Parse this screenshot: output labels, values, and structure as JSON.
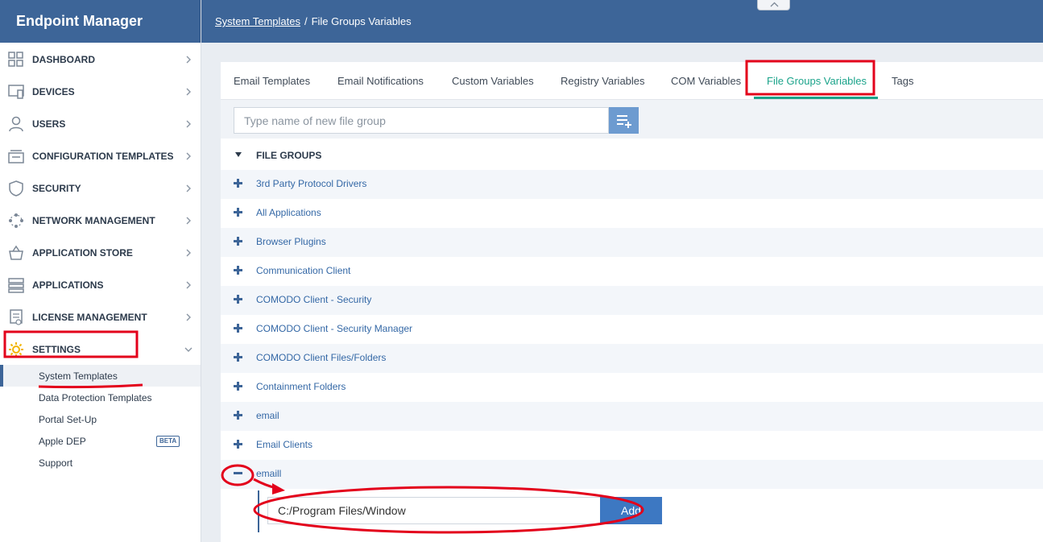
{
  "app": {
    "title": "Endpoint Manager"
  },
  "breadcrumb": {
    "parent": "System Templates",
    "separator": "/",
    "current": "File Groups Variables"
  },
  "sidebar": {
    "items": [
      {
        "label": "DASHBOARD",
        "icon": "dashboard-icon"
      },
      {
        "label": "DEVICES",
        "icon": "devices-icon"
      },
      {
        "label": "USERS",
        "icon": "user-icon"
      },
      {
        "label": "CONFIGURATION TEMPLATES",
        "icon": "templates-icon"
      },
      {
        "label": "SECURITY",
        "icon": "shield-icon"
      },
      {
        "label": "NETWORK MANAGEMENT",
        "icon": "network-icon"
      },
      {
        "label": "APPLICATION STORE",
        "icon": "basket-icon"
      },
      {
        "label": "APPLICATIONS",
        "icon": "applications-icon"
      },
      {
        "label": "LICENSE MANAGEMENT",
        "icon": "license-icon"
      },
      {
        "label": "SETTINGS",
        "icon": "gear-icon"
      }
    ],
    "settings_subitems": [
      {
        "label": "System Templates"
      },
      {
        "label": "Data Protection Templates"
      },
      {
        "label": "Portal Set-Up"
      },
      {
        "label": "Apple DEP",
        "badge": "BETA"
      },
      {
        "label": "Support"
      }
    ]
  },
  "tabs": [
    {
      "label": "Email Templates"
    },
    {
      "label": "Email Notifications"
    },
    {
      "label": "Custom Variables"
    },
    {
      "label": "Registry Variables"
    },
    {
      "label": "COM Variables"
    },
    {
      "label": "File Groups Variables",
      "active": true
    },
    {
      "label": "Tags"
    }
  ],
  "toolbar": {
    "search_placeholder": "Type name of new file group",
    "add_icon": "add-list-icon"
  },
  "file_groups": {
    "title": "FILE GROUPS",
    "items": [
      {
        "label": "3rd Party Protocol Drivers"
      },
      {
        "label": "All Applications"
      },
      {
        "label": "Browser Plugins"
      },
      {
        "label": "Communication Client"
      },
      {
        "label": "COMODO Client - Security"
      },
      {
        "label": "COMODO Client - Security Manager"
      },
      {
        "label": "COMODO Client Files/Folders"
      },
      {
        "label": "Containment Folders"
      },
      {
        "label": "email"
      },
      {
        "label": "Email Clients"
      },
      {
        "label": "emaill",
        "expanded": true
      }
    ]
  },
  "expanded_group": {
    "path_value": "C:/Program Files/Window",
    "add_label": "Add"
  },
  "colors": {
    "brand": "#3d6598",
    "accent": "#1aa38a",
    "annotation": "#e3001b",
    "link": "#3468a6"
  }
}
